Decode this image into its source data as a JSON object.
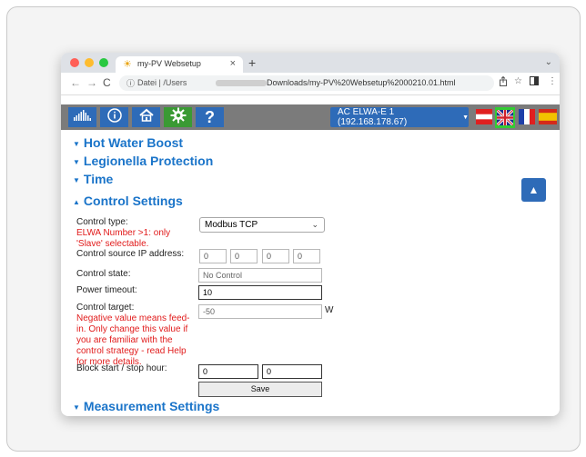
{
  "browser": {
    "tab_title": "my-PV Websetup",
    "tab_close": "×",
    "new_tab": "+",
    "tab_menu": "⌄",
    "url_prefix": "Datei | /Users",
    "url_rest": "Downloads/my-PV%20Websetup%2000210.01.html",
    "nav_back": "←",
    "nav_forward": "→",
    "nav_reload": "C"
  },
  "header": {
    "nav_icons": [
      "chart-icon",
      "info-icon",
      "home-icon",
      "gear-icon",
      "help-icon"
    ],
    "help_label": "?",
    "device_select": "AC ELWA-E 1 (192.168.178.67)",
    "languages": [
      "de-AT",
      "en-GB",
      "fr",
      "es"
    ]
  },
  "sections": {
    "hot_water_boost": "Hot Water Boost",
    "legionella_protection": "Legionella Protection",
    "time": "Time",
    "control_settings": "Control Settings",
    "measurement_settings": "Measurement Settings"
  },
  "control": {
    "type_label": "Control type:",
    "type_hint": "ELWA Number >1: only 'Slave' selectable.",
    "type_value": "Modbus TCP",
    "source_ip_label": "Control source IP address:",
    "ip": [
      "0",
      "0",
      "0",
      "0"
    ],
    "state_label": "Control state:",
    "state_value": "No Control",
    "timeout_label": "Power timeout:",
    "timeout_value": "10",
    "target_label": "Control target:",
    "target_hint": "Negative value means feed-in. Only change this value if you are familiar with the control strategy - read Help for more details.",
    "target_value": "-50",
    "target_unit": "W",
    "block_label": "Block start / stop hour:",
    "block_start": "0",
    "block_stop": "0",
    "save_label": "Save"
  },
  "colors": {
    "accent": "#1a74c9",
    "button_blue": "#2e6bb8",
    "header_gray": "#7b7b7b",
    "hint_red": "#e11b1b"
  }
}
